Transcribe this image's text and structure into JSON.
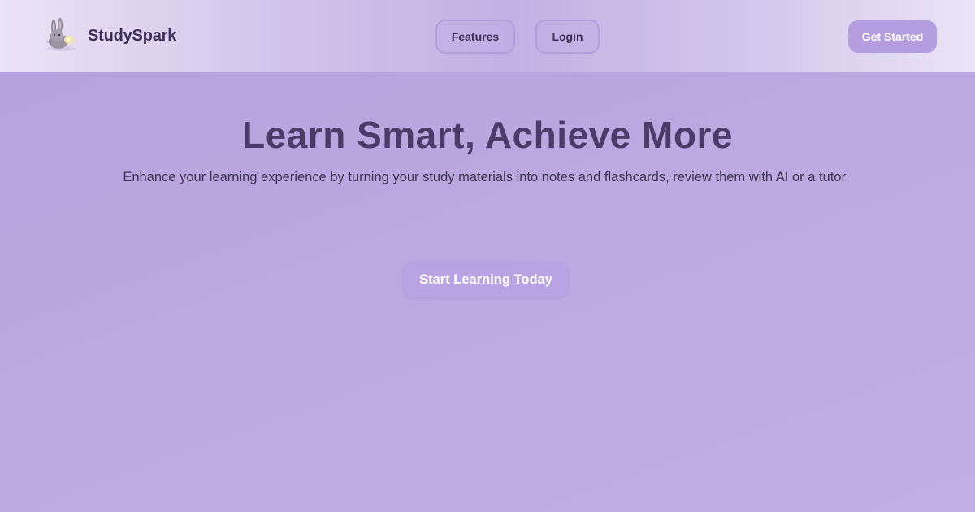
{
  "brand": {
    "name": "StudySpark",
    "logo_icon": "bunny-mascot-icon"
  },
  "nav": {
    "features_label": "Features",
    "login_label": "Login",
    "cta_label": "Get Started"
  },
  "hero": {
    "title": "Learn Smart, Achieve More",
    "subtitle": "Enhance your learning experience by turning your study materials into notes and flashcards, review them with AI or a tutor.",
    "cta_label": "Start Learning Today"
  },
  "colors": {
    "background": "#bba5e0",
    "accent": "#b49ee0",
    "heading": "#4c3a68",
    "text": "#3d3350"
  }
}
